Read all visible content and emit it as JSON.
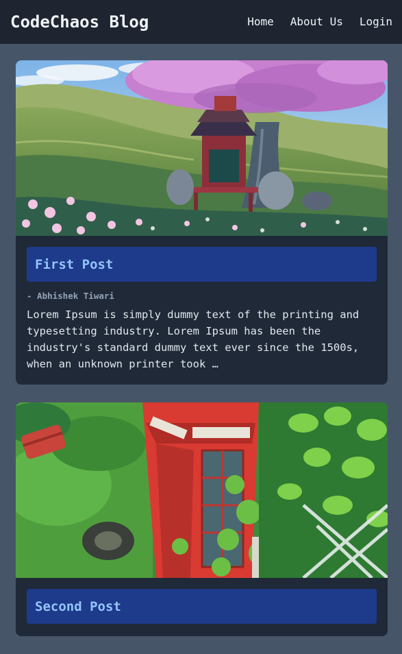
{
  "header": {
    "brand": "CodeChaos Blog",
    "nav": {
      "home": "Home",
      "about": "About Us",
      "login": "Login"
    }
  },
  "posts": [
    {
      "title": "First Post",
      "author": "- Abhishek Tiwari",
      "excerpt": "Lorem Ipsum is simply dummy text of the printing and typesetting industry. Lorem Ipsum has been the industry's standard dummy text ever since the 1500s, when an unknown printer took …",
      "image_scene": "anime-shrine-under-cherry-tree"
    },
    {
      "title": "Second Post",
      "image_scene": "anime-red-telephone-box-overgrown"
    }
  ],
  "colors": {
    "page_bg": "#475569",
    "navbar_bg": "#1e2430",
    "card_bg": "#1f2937",
    "title_bar_bg": "#1e3a8a",
    "title_text": "#93c5fd",
    "author_text": "#94a3b8"
  }
}
